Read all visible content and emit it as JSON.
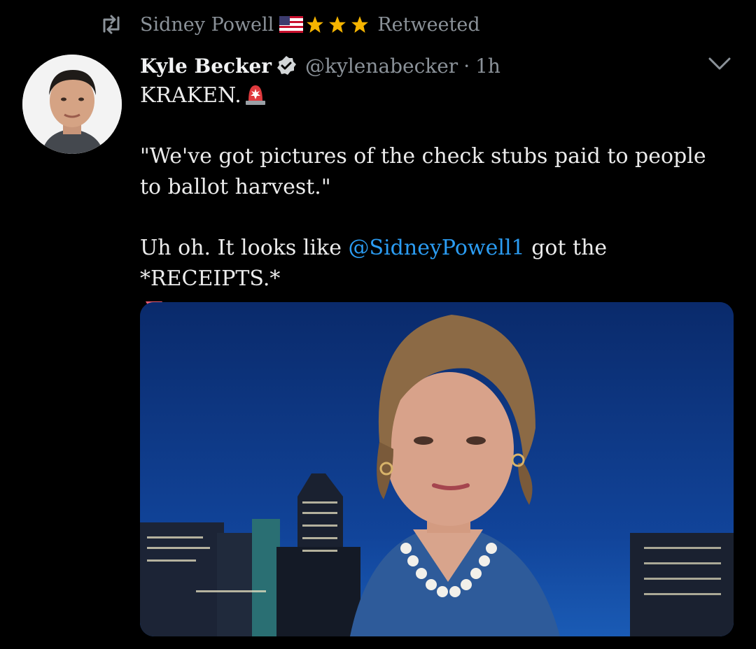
{
  "retweet": {
    "user_name": "Sidney Powell",
    "label": "Retweeted"
  },
  "tweet": {
    "display_name": "Kyle Becker",
    "handle": "@kylenabecker",
    "separator": "·",
    "time": "1h",
    "line1": "KRAKEN.",
    "quote": "\"We've got pictures of the check stubs paid to people to ballot harvest.\"",
    "text_before_mention": "Uh oh. It looks like ",
    "mention": "@SidneyPowell1",
    "text_after_mention": " got the *RECEIPTS.*"
  },
  "icons": {
    "retweet": "retweet-icon",
    "flag": "us-flag-emoji",
    "stars": [
      "star-emoji",
      "star-emoji",
      "star-emoji"
    ],
    "verified": "verified-badge-icon",
    "more": "chevron-down-icon",
    "siren": "police-light-emoji",
    "triangle": "red-triangle-down-emoji"
  },
  "colors": {
    "background": "#000000",
    "text": "#ececec",
    "muted": "#8b9299",
    "link": "#2b9cf2",
    "star": "#f5b400"
  }
}
